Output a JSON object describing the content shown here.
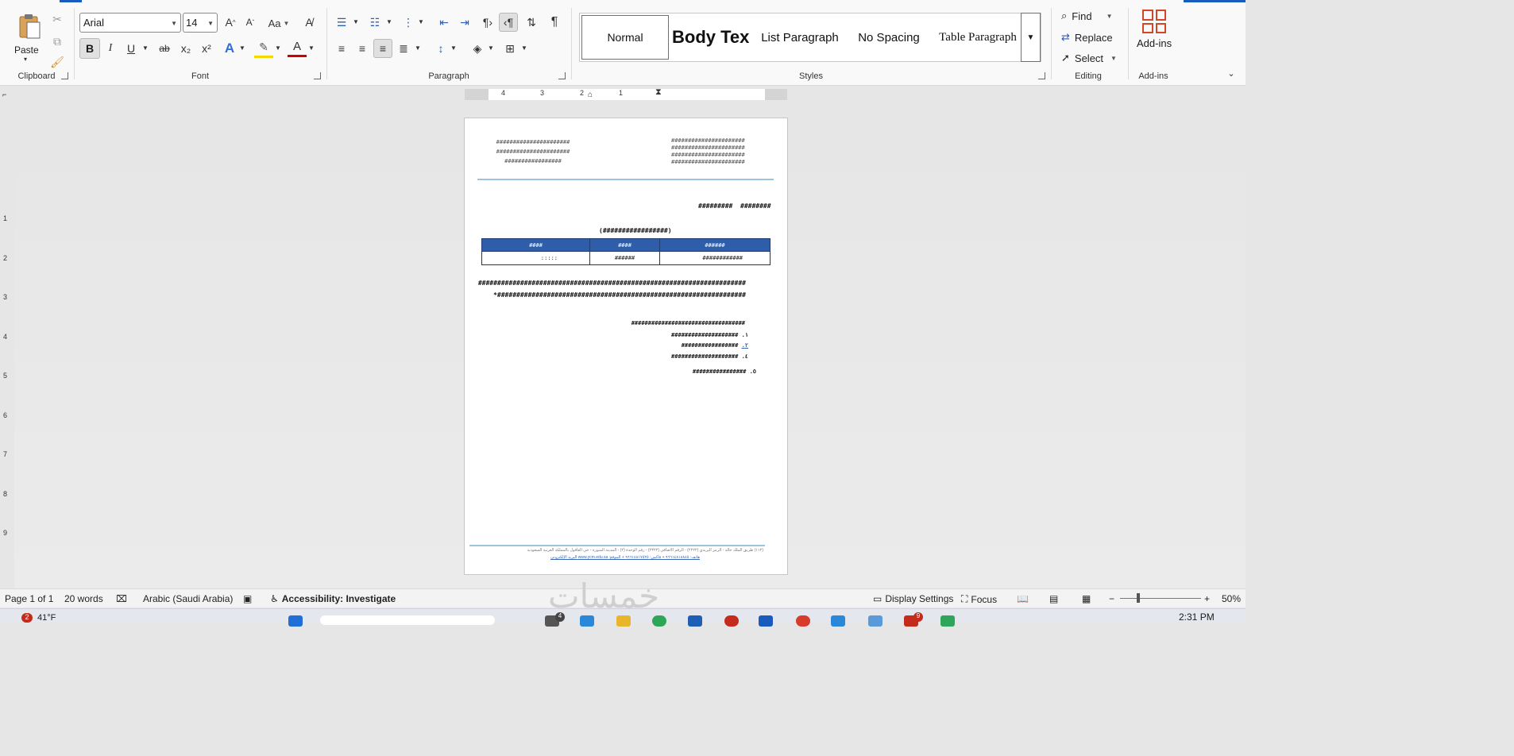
{
  "ribbon": {
    "clipboard": {
      "group_label": "Clipboard",
      "paste_label": "Paste"
    },
    "font": {
      "group_label": "Font",
      "font_name": "Arial",
      "font_size": "14",
      "bold": "B",
      "italic": "I",
      "underline": "U",
      "strike": "ab",
      "subscript": "x₂",
      "superscript": "x²",
      "text_effects": "A",
      "font_color": "A",
      "change_case": "Aa"
    },
    "paragraph": {
      "group_label": "Paragraph",
      "show_marks": "¶"
    },
    "styles": {
      "group_label": "Styles",
      "items": [
        "Normal",
        "Body Tex",
        "List Paragraph",
        "No Spacing",
        "Table Paragraph"
      ]
    },
    "editing": {
      "group_label": "Editing",
      "find": "Find",
      "replace": "Replace",
      "select": "Select"
    },
    "addins": {
      "group_label": "Add-ins",
      "button_label": "Add-ins"
    }
  },
  "ruler": {
    "h_numbers": [
      "4",
      "3",
      "2",
      "1"
    ],
    "v_numbers": [
      "1",
      "2",
      "3",
      "4",
      "5",
      "6",
      "7",
      "8",
      "9"
    ]
  },
  "document": {
    "header_left": [
      "######################",
      "######################",
      "#################"
    ],
    "header_right": [
      "######################",
      "######################",
      "######################",
      "######################"
    ],
    "date_line": {
      "a": "#########",
      "b": "########"
    },
    "table_title": "(#################)",
    "table_headers": [
      "####",
      "####",
      "######"
    ],
    "table_row": [
      ":::::",
      "######",
      "############"
    ],
    "body_line1": "######################################################################",
    "body_line2": "*#################################################################",
    "list_intro": "##################################",
    "list_items": [
      {
        "text": "####################",
        "num": ".١"
      },
      {
        "text": "#################",
        "num": ".٢"
      },
      {
        "text": "####################",
        "num": ".٤"
      },
      {
        "text": "################",
        "num": ".٥"
      }
    ],
    "footer_line1": "(١١٢) طريق الملك خالد - الرمز البريدي (٢٢٢٢) - الرقم الاضافي (٢٣٢٢) - رقم الوحدة (٢) - المدينة المنورة - حي العاقول بالمملكة العربية السعودية",
    "footer_line2": "هاتف: ٩٦٦١٤٨١٨٨٤٥ +  فاكس: ٩٦٦١٤٨١٧٥٢٥ +  الموقع: www.ycm.edu.sa  البريد الإلكتروني"
  },
  "status": {
    "page": "Page 1 of 1",
    "words": "20 words",
    "language": "Arabic (Saudi Arabia)",
    "accessibility": "Accessibility: Investigate",
    "display_settings": "Display Settings",
    "focus": "Focus",
    "zoom": "50%"
  },
  "watermark": "خمسات",
  "taskbar": {
    "weather_temp": "41°F",
    "weather_badge": "2",
    "time": "2:31 PM",
    "badge_a": "4",
    "badge_b": "9"
  },
  "colors": {
    "accent": "#185abd",
    "table_header": "#2e5eaa",
    "header_rule": "#9ec3dd",
    "addins": "#d24726"
  }
}
